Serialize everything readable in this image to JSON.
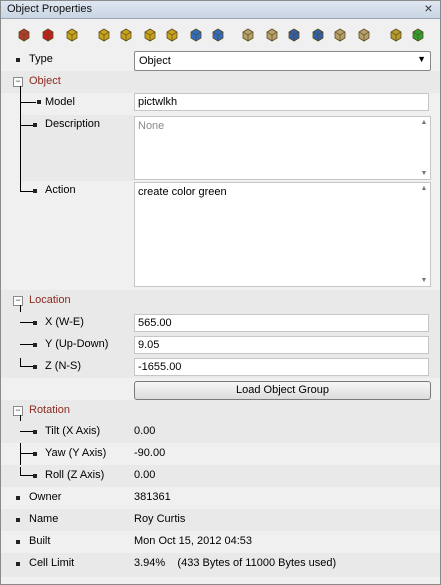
{
  "window": {
    "title": "Object Properties",
    "close_glyph": "×"
  },
  "toolbar": [
    {
      "name": "object-copy-icon",
      "color": "#b23b2b"
    },
    {
      "name": "object-delete-icon",
      "color": "#c41e1e"
    },
    {
      "name": "object-select-icon",
      "color": "#c8a21a"
    },
    {
      "name": "move-up-icon",
      "color": "#c8a21a"
    },
    {
      "name": "move-forward-icon",
      "color": "#c8a21a"
    },
    {
      "name": "move-left-icon",
      "color": "#c8a21a"
    },
    {
      "name": "move-right-icon",
      "color": "#c8a21a"
    },
    {
      "name": "snap-icon",
      "color": "#2e6dc4"
    },
    {
      "name": "drop-icon",
      "color": "#2e6dc4"
    },
    {
      "name": "rotate-left-icon",
      "color": "#b6a06a"
    },
    {
      "name": "rotate-right-icon",
      "color": "#b6a06a"
    },
    {
      "name": "rotate-tilt-icon",
      "color": "#2e5fa8"
    },
    {
      "name": "rotate-yaw-icon",
      "color": "#2e5fa8"
    },
    {
      "name": "rotate-roll-icon",
      "color": "#b6a06a"
    },
    {
      "name": "rotate-reset-icon",
      "color": "#b6a06a"
    },
    {
      "name": "grid-icon",
      "color": "#b59a2a"
    },
    {
      "name": "select-all-icon",
      "color": "#2fa02f"
    }
  ],
  "props": {
    "type": {
      "label": "Type",
      "value": "Object"
    },
    "object": {
      "header": "Object",
      "model": {
        "label": "Model",
        "value": "pictwlkh"
      },
      "description": {
        "label": "Description",
        "placeholder": "None"
      },
      "action": {
        "label": "Action",
        "value": "create color green"
      }
    },
    "location": {
      "header": "Location",
      "x": {
        "label": "X (W-E)",
        "value": "565.00"
      },
      "y": {
        "label": "Y (Up-Down)",
        "value": "9.05"
      },
      "z": {
        "label": "Z (N-S)",
        "value": "-1655.00"
      },
      "load_group_label": "Load Object Group"
    },
    "rotation": {
      "header": "Rotation",
      "tilt": {
        "label": "Tilt (X Axis)",
        "value": "0.00"
      },
      "yaw": {
        "label": "Yaw (Y Axis)",
        "value": "-90.00"
      },
      "roll": {
        "label": "Roll (Z Axis)",
        "value": "0.00"
      }
    },
    "owner": {
      "label": "Owner",
      "value": "381361"
    },
    "name": {
      "label": "Name",
      "value": "Roy Curtis"
    },
    "built": {
      "label": "Built",
      "value": "Mon Oct 15, 2012 04:53"
    },
    "cell_limit": {
      "label": "Cell Limit",
      "value": "3.94%    (433 Bytes of 11000 Bytes used)"
    }
  }
}
